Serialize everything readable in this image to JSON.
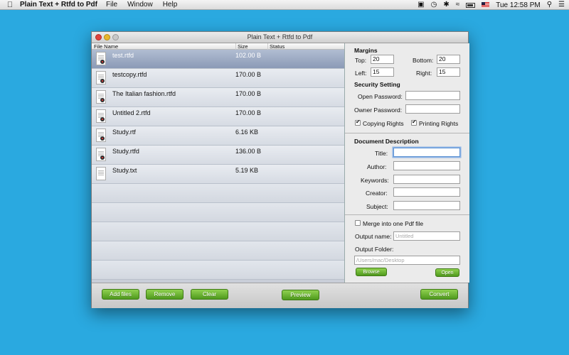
{
  "menubar": {
    "app_name": "Plain Text + Rtfd to Pdf",
    "menus": [
      "File",
      "Window",
      "Help"
    ],
    "clock": "Tue 12:58 PM"
  },
  "window": {
    "title": "Plain Text + Rtfd to Pdf"
  },
  "file_list": {
    "columns": [
      "File Name",
      "Size",
      "Status"
    ],
    "rows": [
      {
        "name": "test.rtfd",
        "size": "102.00 B",
        "status": ""
      },
      {
        "name": "testcopy.rtfd",
        "size": "170.00 B",
        "status": ""
      },
      {
        "name": "The Italian fashion.rtfd",
        "size": "170.00 B",
        "status": ""
      },
      {
        "name": "Untitled 2.rtfd",
        "size": "170.00 B",
        "status": ""
      },
      {
        "name": "Study.rtf",
        "size": "6.16 KB",
        "status": ""
      },
      {
        "name": "Study.rtfd",
        "size": "136.00 B",
        "status": ""
      },
      {
        "name": "Study.txt",
        "size": "5.19 KB",
        "status": ""
      }
    ]
  },
  "margins": {
    "title": "Margins",
    "top_label": "Top:",
    "top_value": "20",
    "bottom_label": "Bottom:",
    "bottom_value": "20",
    "left_label": "Left:",
    "left_value": "15",
    "right_label": "Right:",
    "right_value": "15"
  },
  "security": {
    "title": "Security Setting",
    "open_password_label": "Open Password:",
    "owner_password_label": "Owner Password:",
    "copying_rights_label": "Copying Rights",
    "printing_rights_label": "Printing Rights"
  },
  "document_description": {
    "title": "Document Description",
    "title_label": "Title:",
    "author_label": "Author:",
    "keywords_label": "Keywords:",
    "creator_label": "Creator:",
    "subject_label": "Subject:"
  },
  "output": {
    "merge_label": "Merge into one Pdf file",
    "output_name_label": "Output name:",
    "output_name_placeholder": "Untitled",
    "output_folder_label": "Output Folder:",
    "output_folder_placeholder": "/Users/mac/Desktop",
    "browse_label": "Browse",
    "open_label": "Open"
  },
  "toolbar": {
    "add_files_label": "Add files",
    "remove_label": "Remove",
    "clear_label": "Clear",
    "preview_label": "Preview",
    "convert_label": "Convert"
  }
}
